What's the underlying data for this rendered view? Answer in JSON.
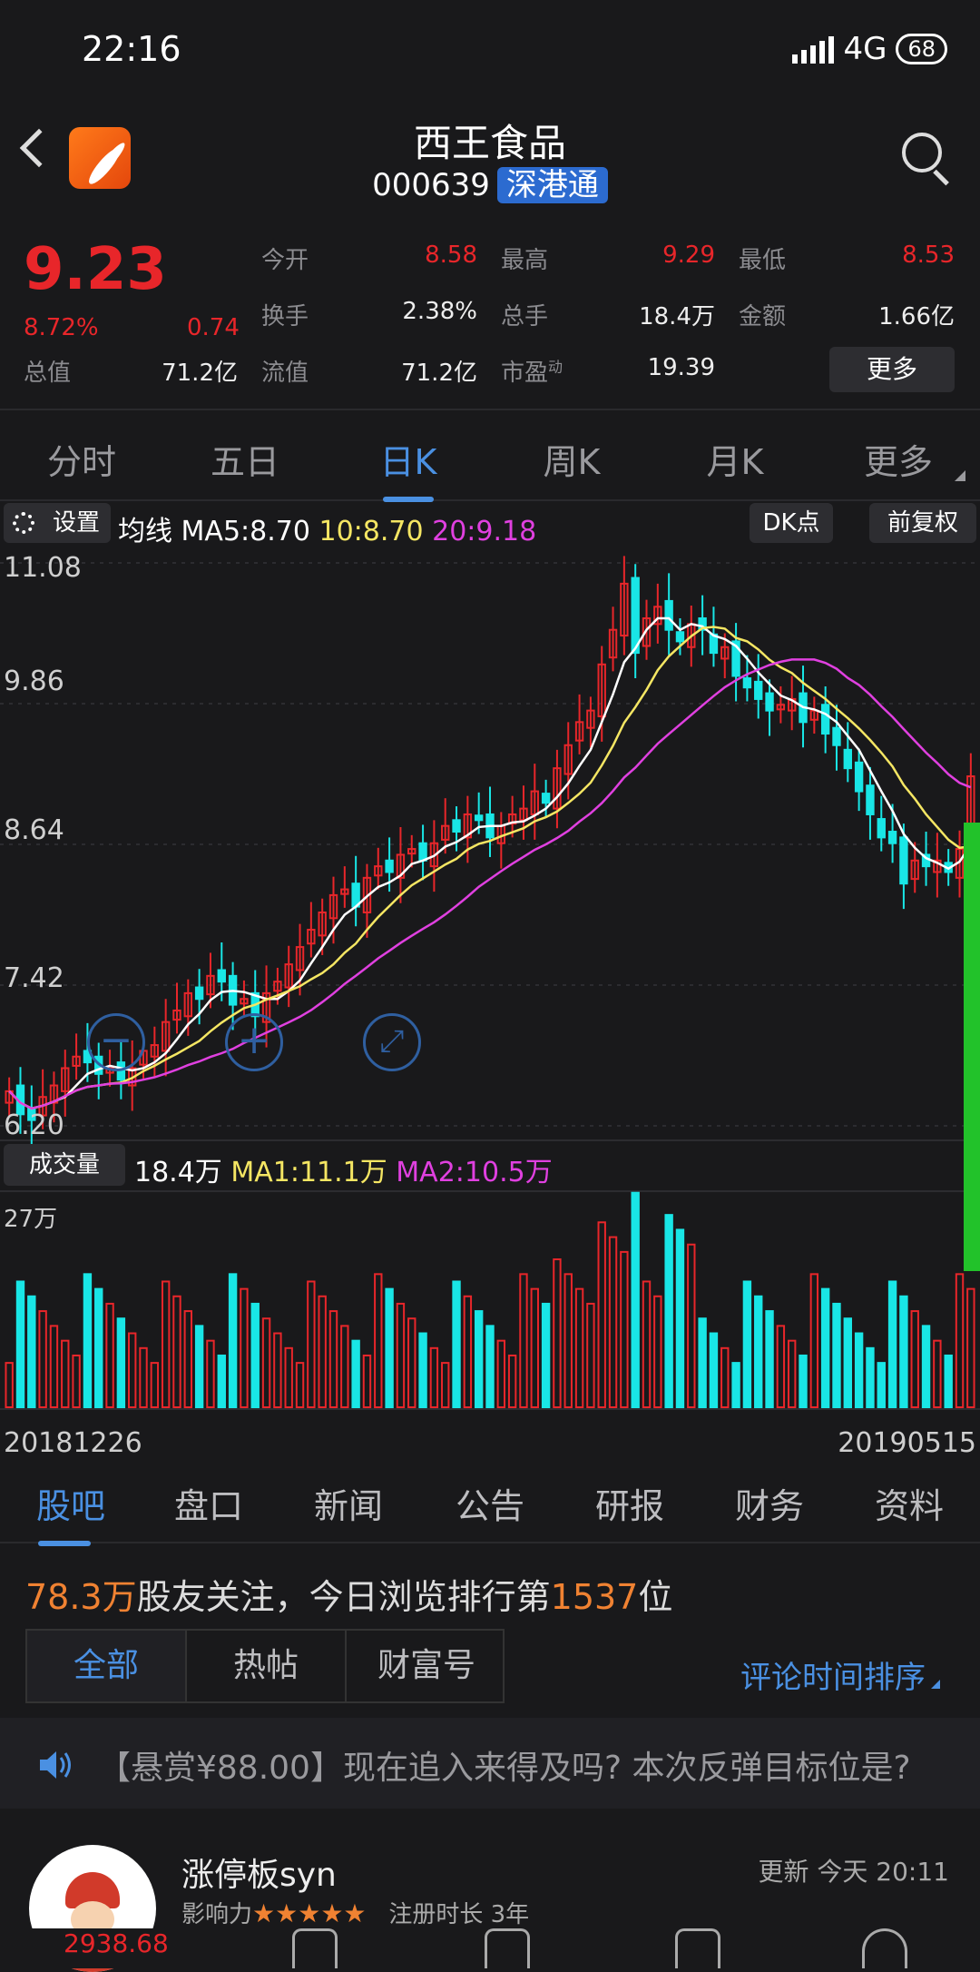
{
  "status": {
    "time": "22:16",
    "network": "4G",
    "battery": "68"
  },
  "header": {
    "name": "西王食品",
    "code": "000639",
    "tag": "深港通"
  },
  "quote": {
    "price": "9.23",
    "pct": "8.72%",
    "change": "0.74",
    "open_label": "今开",
    "open": "8.58",
    "high_label": "最高",
    "high": "9.29",
    "low_label": "最低",
    "low": "8.53",
    "turnover_label": "换手",
    "turnover": "2.38%",
    "hands_label": "总手",
    "hands": "18.4万",
    "amount_label": "金额",
    "amount": "1.66亿",
    "mktcap_label": "总值",
    "mktcap": "71.2亿",
    "float_label": "流值",
    "float": "71.2亿",
    "pe_label": "市盈",
    "pe_sup": "动",
    "pe": "19.39",
    "more": "更多"
  },
  "ktabs": [
    "分时",
    "五日",
    "日K",
    "周K",
    "月K",
    "更多"
  ],
  "ma": {
    "settings": "设置",
    "label": "均线",
    "ma5": "MA5:8.70",
    "ma10": "10:8.70",
    "ma20": "20:9.18",
    "dk": "DK点",
    "adjust": "前复权"
  },
  "chart_data": {
    "type": "candlestick",
    "y_ticks": [
      "11.08",
      "9.86",
      "8.64",
      "7.42",
      "6.20"
    ],
    "ylim": [
      6.2,
      11.08
    ],
    "x_start": "20181226",
    "x_end": "20190515",
    "close": [
      6.5,
      6.3,
      6.25,
      6.45,
      6.55,
      6.7,
      6.8,
      6.75,
      6.65,
      6.7,
      6.6,
      6.7,
      6.85,
      6.9,
      7.1,
      7.2,
      7.35,
      7.3,
      7.5,
      7.45,
      7.25,
      7.3,
      7.15,
      7.35,
      7.45,
      7.6,
      7.75,
      7.9,
      8.05,
      8.2,
      8.25,
      8.1,
      8.35,
      8.45,
      8.4,
      8.55,
      8.6,
      8.5,
      8.65,
      8.8,
      8.75,
      8.9,
      8.85,
      8.7,
      8.8,
      8.9,
      8.95,
      9.1,
      9.0,
      9.3,
      9.5,
      9.7,
      9.8,
      10.2,
      10.5,
      10.9,
      10.3,
      10.6,
      10.7,
      10.5,
      10.4,
      10.55,
      10.5,
      10.3,
      10.35,
      10.1,
      10.0,
      9.9,
      9.8,
      9.85,
      9.9,
      9.7,
      9.8,
      9.6,
      9.5,
      9.3,
      9.1,
      8.9,
      8.7,
      8.65,
      8.3,
      8.5,
      8.45,
      8.5,
      8.4,
      8.6,
      9.23
    ],
    "volume": {
      "ylabel": "27万",
      "ymax": 27,
      "legend": "成交量",
      "value": "18.4万",
      "ma1": "MA1:11.1万",
      "ma2": "MA2:10.5万"
    }
  },
  "subtabs": [
    "股吧",
    "盘口",
    "新闻",
    "公告",
    "研报",
    "财务",
    "资料"
  ],
  "follow": {
    "count": "78.3万",
    "mid": "股友关注，今日浏览排行第",
    "rank": "1537",
    "end": "位"
  },
  "filters": [
    "全部",
    "热帖",
    "财富号"
  ],
  "sort": "评论时间排序",
  "notice": "【悬赏¥88.00】现在追入来得及吗? 本次反弹目标位是?",
  "post": {
    "user": "涨停板syn",
    "updated": "更新 今天 20:11",
    "influence": "影响力",
    "stars": "★★★★★",
    "reg": "注册时长 3年"
  },
  "bottom": {
    "index_val": "2938.68"
  }
}
